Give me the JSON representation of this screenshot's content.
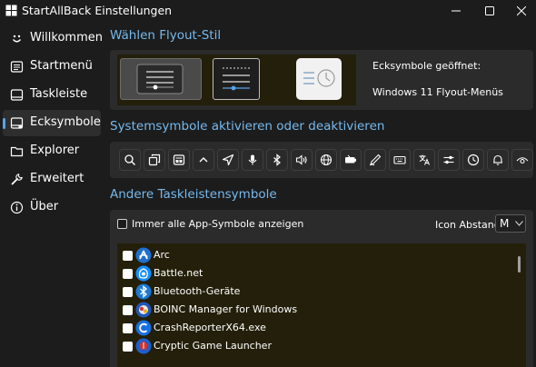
{
  "window": {
    "title": "StartAllBack Einstellungen",
    "buttons": {
      "minimize": "minimize-icon",
      "maximize": "maximize-icon",
      "close": "close-icon"
    }
  },
  "sidebar": {
    "items": [
      {
        "label": "Willkommen",
        "icon": "smile-icon",
        "active": false
      },
      {
        "label": "Startmenü",
        "icon": "start-menu-icon",
        "active": false
      },
      {
        "label": "Taskleiste",
        "icon": "taskbar-icon",
        "active": false
      },
      {
        "label": "Ecksymbole",
        "icon": "tray-icon",
        "active": true
      },
      {
        "label": "Explorer",
        "icon": "folder-icon",
        "active": false
      },
      {
        "label": "Erweitert",
        "icon": "wrench-icon",
        "active": false
      },
      {
        "label": "Über",
        "icon": "info-icon",
        "active": false
      }
    ]
  },
  "flyout": {
    "heading": "Wählen Flyout-Stil",
    "opened_label": "Ecksymbole geöffnet:",
    "style_label": "Windows 11 Flyout-Menüs"
  },
  "system_icons": {
    "heading": "Systemsymbole aktivieren oder deaktivieren",
    "icons": [
      "search-icon",
      "task-view-icon",
      "widgets-icon",
      "chevron-up-icon",
      "location-icon",
      "microphone-icon",
      "bluetooth-icon",
      "volume-icon",
      "network-icon",
      "battery-icon",
      "pen-icon",
      "keyboard-icon",
      "language-icon",
      "sliders-icon",
      "clock-icon",
      "bell-icon",
      "eye-icon"
    ]
  },
  "other_icons": {
    "heading": "Andere Taskleistensymbole",
    "show_all_label": "Immer alle App-Symbole anzeigen",
    "icon_gap_label": "Icon Abstand",
    "icon_gap_value": "M",
    "apps": [
      {
        "name": "Arc",
        "icon": "arc-icon"
      },
      {
        "name": "Battle.net",
        "icon": "battlenet-icon"
      },
      {
        "name": "Bluetooth-Geräte",
        "icon": "bluetooth-icon"
      },
      {
        "name": "BOINC Manager for Windows",
        "icon": "boinc-icon"
      },
      {
        "name": "CrashReporterX64.exe",
        "icon": "crash-reporter-icon"
      },
      {
        "name": "Cryptic Game Launcher",
        "icon": "cryptic-icon"
      }
    ]
  },
  "colors": {
    "accent": "#76b9ed",
    "background": "#1c1c1c",
    "panel": "#2b2b2b",
    "list_tint": "#231f0a"
  }
}
